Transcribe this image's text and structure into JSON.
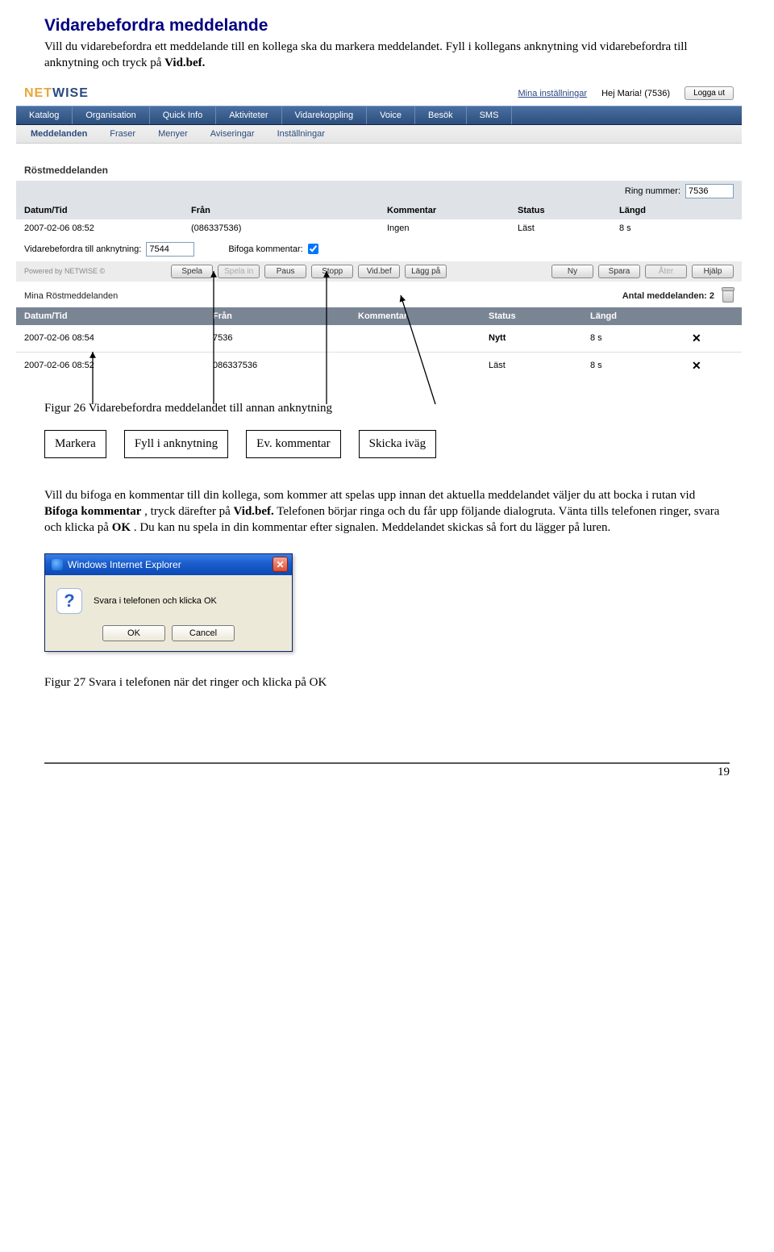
{
  "page": {
    "title": "Vidarebefordra meddelande",
    "intro_pre": "Vill du vidarebefordra ett meddelande till en kollega ska du markera meddelandet. Fyll i kollegans anknytning vid vidarebefordra till anknytning och tryck på ",
    "intro_bold": "Vid.bef.",
    "intro_post": "",
    "caption26": "Figur 26  Vidarebefordra meddelandet till annan anknytning",
    "boxes": {
      "markera": "Markera",
      "fyll": "Fyll i anknytning",
      "ev": "Ev. kommentar",
      "skicka": "Skicka iväg"
    },
    "body2_a": "Vill du bifoga en kommentar till din kollega, som kommer att spelas upp innan det aktuella meddelandet väljer du att bocka i rutan vid ",
    "body2_b": "Bifoga kommentar",
    "body2_c": ", tryck därefter på ",
    "body2_d": "Vid.bef.",
    "body2_e": " Telefonen börjar ringa och du får upp följande dialogruta. Vänta tills telefonen ringer, svara och klicka på ",
    "body2_f": "OK",
    "body2_g": ". Du kan nu spela in din kommentar efter signalen. Meddelandet skickas så fort du lägger på luren.",
    "caption27": "Figur 27  Svara i telefonen när det ringer och klicka på OK",
    "pageno": "19"
  },
  "app": {
    "logo": {
      "nets": "NET",
      "wise": "WISE"
    },
    "top": {
      "settings": "Mina inställningar",
      "greeting": "Hej Maria! (7536)",
      "logout": "Logga ut"
    },
    "tabs": [
      "Katalog",
      "Organisation",
      "Quick Info",
      "Aktiviteter",
      "Vidarekoppling",
      "Voice",
      "Besök",
      "SMS"
    ],
    "subtabs": [
      "Meddelanden",
      "Fraser",
      "Menyer",
      "Aviseringar",
      "Inställningar"
    ],
    "section_title": "Röstmeddelanden",
    "ring_label": "Ring nummer:",
    "ring_value": "7536",
    "cols": {
      "dt": "Datum/Tid",
      "from": "Från",
      "comment": "Kommentar",
      "status": "Status",
      "len": "Längd"
    },
    "detail": {
      "dt": "2007-02-06 08:52",
      "from": "(086337536)",
      "comment": "Ingen",
      "status": "Läst",
      "len": "8 s"
    },
    "fwd_label": "Vidarebefordra till anknytning:",
    "fwd_value": "7544",
    "bifoga_label": "Bifoga kommentar:",
    "btns": [
      "Spela",
      "Spela in",
      "Paus",
      "Stopp",
      "Vid.bef",
      "Lägg på",
      "Ny",
      "Spara",
      "Åter",
      "Hjälp"
    ],
    "powered": "Powered by NETWISE ©",
    "mina_title": "Mina Röstmeddelanden",
    "antal_label": "Antal meddelanden: 2",
    "rows": [
      {
        "dt": "2007-02-06 08:54",
        "from": "7536",
        "comment": "",
        "status": "Nytt",
        "len": "8 s"
      },
      {
        "dt": "2007-02-06 08:52",
        "from": "086337536",
        "comment": "",
        "status": "Läst",
        "len": "8 s"
      }
    ]
  },
  "dialog": {
    "title": "Windows Internet Explorer",
    "msg": "Svara i telefonen och klicka OK",
    "ok": "OK",
    "cancel": "Cancel"
  }
}
